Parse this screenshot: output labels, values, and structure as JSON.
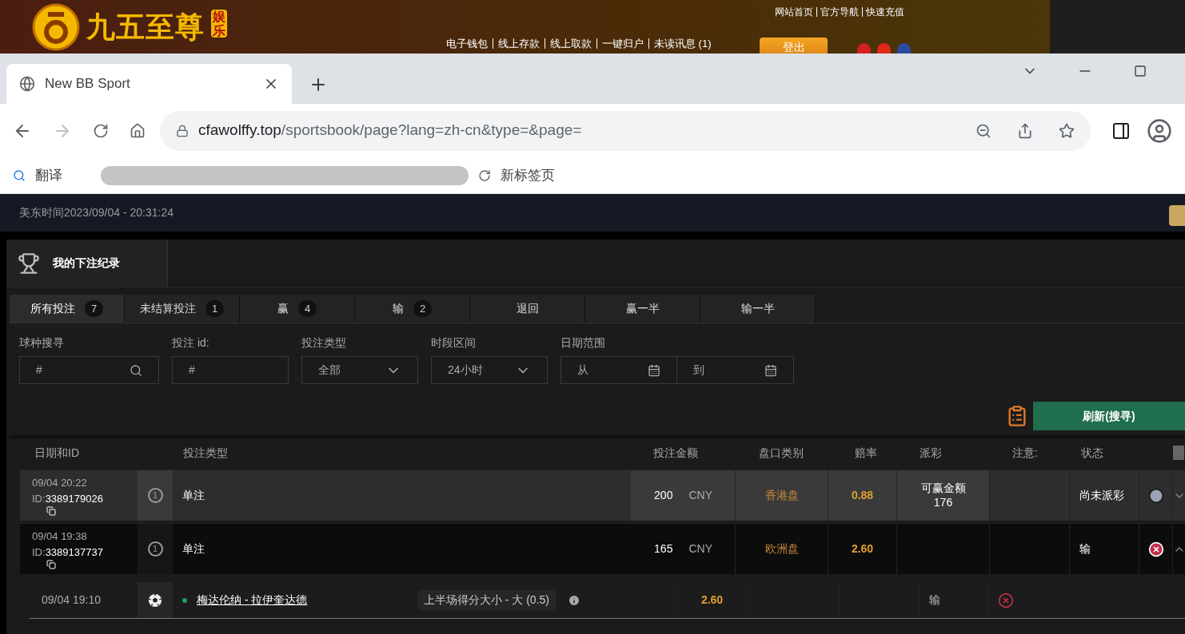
{
  "banner": {
    "logo_text": "九五至尊",
    "logo_side": "娱乐",
    "top_links": [
      "网站首页",
      "官方导航",
      "快速充值"
    ],
    "account_links": [
      "电子钱包",
      "线上存款",
      "线上取款",
      "一键归户",
      "未读讯息 (1)"
    ],
    "logout_button": "登出"
  },
  "browser": {
    "tab_title": "New BB Sport",
    "url_domain": "cfawolffy.top",
    "url_path": "/sportsbook/page?lang=zh-cn&type=&page=",
    "bookmarks": [
      "翻译",
      "新标签页"
    ]
  },
  "clock": "美东时间2023/09/04 - 20:31:24",
  "panel": {
    "title": "我的下注纪录"
  },
  "tabs": [
    {
      "label": "所有投注",
      "count": "7",
      "selected": true
    },
    {
      "label": "未结算投注",
      "count": "1",
      "selected": false
    },
    {
      "label": "赢",
      "count": "4",
      "selected": false
    },
    {
      "label": "输",
      "count": "2",
      "selected": false
    },
    {
      "label": "退回",
      "selected": false
    },
    {
      "label": "赢一半",
      "selected": false
    },
    {
      "label": "输一半",
      "selected": false
    }
  ],
  "filters": [
    {
      "kind": "search",
      "label": "球种搜寻",
      "placeholder": "#"
    },
    {
      "kind": "text",
      "label": "投注 id:",
      "placeholder": "#"
    },
    {
      "kind": "select",
      "label": "投注类型",
      "value": "全部"
    },
    {
      "kind": "select",
      "label": "时段区间",
      "value": "24小时"
    },
    {
      "kind": "daterange",
      "label": "日期范围",
      "from": "从",
      "to": "到"
    }
  ],
  "refresh_button": "刷新(搜寻)",
  "columns": [
    "日期和ID",
    "投注类型",
    "投注金额",
    "盘口类别",
    "赔率",
    "派彩",
    "注意:",
    "状态"
  ],
  "bets": [
    {
      "date": "09/04 20:22",
      "id_label": "ID:",
      "id": "3389179026",
      "legs_icon": "1",
      "type": "单注",
      "amount": "200",
      "currency": "CNY",
      "market": "香港盘",
      "odds": "0.88",
      "payout_label": "可赢金额",
      "payout": "176",
      "status": "尚未派彩",
      "settled": false,
      "highlighted": true,
      "expanded": false
    },
    {
      "date": "09/04 19:38",
      "id_label": "ID:",
      "id": "3389137737",
      "legs_icon": "1",
      "type": "单注",
      "amount": "165",
      "currency": "CNY",
      "market": "欧洲盘",
      "odds": "2.60",
      "status": "输",
      "settled": true,
      "highlighted": false,
      "expanded": true,
      "children": [
        {
          "time": "09/04 19:10",
          "match": "梅达伦纳 - 拉伊奎达德",
          "pick": "上半场得分大小 - 大 (0.5)",
          "odds": "2.60",
          "status": "输",
          "settled": true
        }
      ]
    }
  ]
}
